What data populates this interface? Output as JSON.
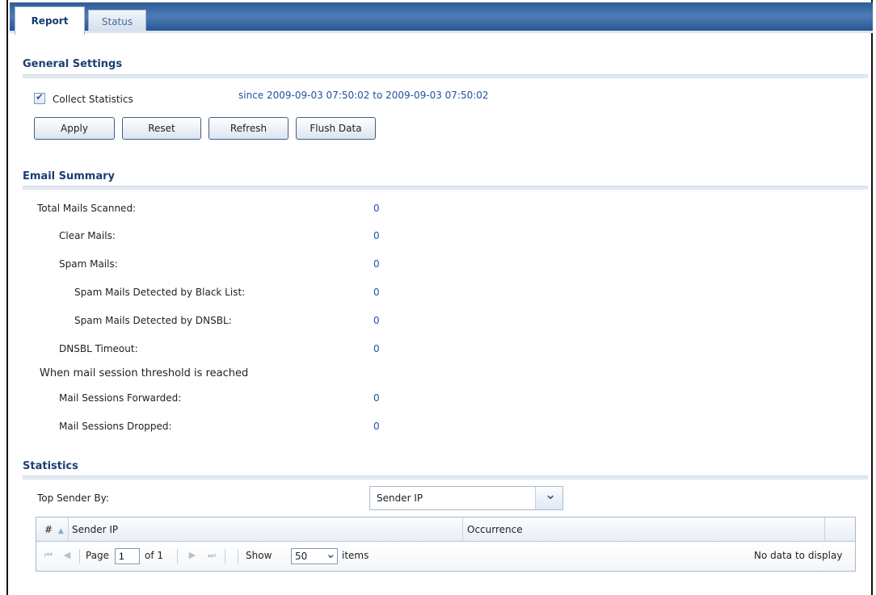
{
  "tabs": [
    {
      "label": "Report",
      "active": true
    },
    {
      "label": "Status",
      "active": false
    }
  ],
  "general_settings": {
    "title": "General Settings",
    "collect_statistics_label": "Collect Statistics",
    "collect_statistics_checked": true,
    "since_text": "since 2009-09-03 07:50:02 to 2009-09-03 07:50:02",
    "buttons": {
      "apply": "Apply",
      "reset": "Reset",
      "refresh": "Refresh",
      "flush": "Flush Data"
    }
  },
  "email_summary": {
    "title": "Email Summary",
    "rows": [
      {
        "label": "Total Mails Scanned:",
        "value": "0"
      },
      {
        "label": "Clear Mails:",
        "value": "0"
      },
      {
        "label": "Spam Mails:",
        "value": "0"
      },
      {
        "label": "Spam Mails Detected by Black List:",
        "value": "0"
      },
      {
        "label": "Spam Mails Detected by DNSBL:",
        "value": "0"
      },
      {
        "label": "DNSBL Timeout:",
        "value": "0"
      },
      {
        "label": "Mail Sessions Forwarded:",
        "value": "0"
      },
      {
        "label": "Mail Sessions Dropped:",
        "value": "0"
      }
    ],
    "threshold_text": "When mail session threshold is reached"
  },
  "statistics": {
    "title": "Statistics",
    "top_sender_label": "Top Sender By:",
    "top_sender_value": "Sender IP",
    "grid": {
      "columns": [
        "#",
        "Sender IP",
        "Occurrence"
      ],
      "sort_indicator": "▲"
    },
    "pager": {
      "page_label": "Page",
      "page_value": "1",
      "of_label": "of 1",
      "show_label": "Show",
      "show_value": "50",
      "items_label": "items",
      "empty_text": "No data to display"
    }
  },
  "icons": {
    "first": "⏮",
    "prev": "◀",
    "next": "▶",
    "last": "⏭"
  }
}
